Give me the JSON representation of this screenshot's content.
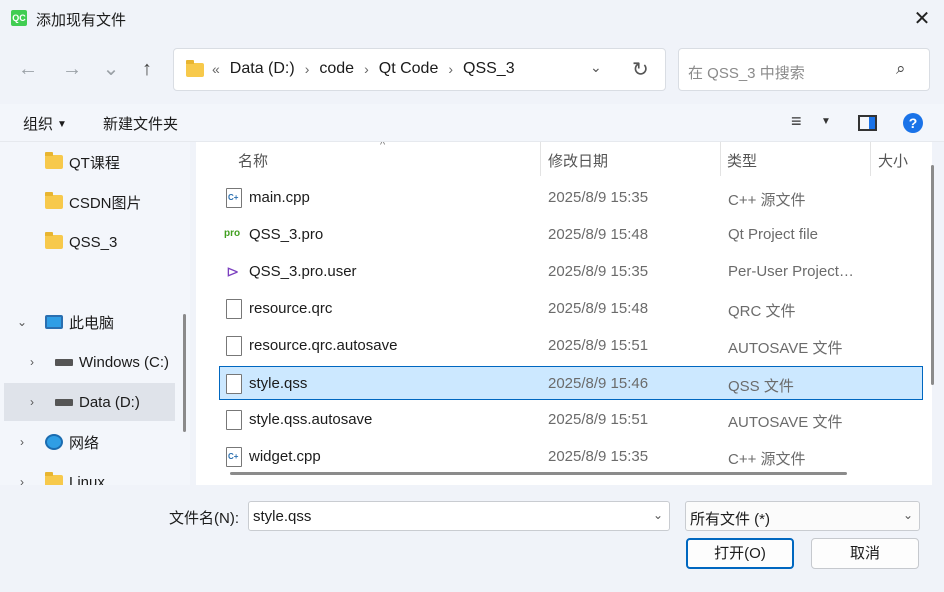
{
  "window": {
    "app_icon_text": "QC",
    "title": "添加现有文件",
    "close_glyph": "✕"
  },
  "nav": {
    "back_glyph": "←",
    "forward_glyph": "→",
    "recent_glyph": "⌄",
    "up_glyph": "↑"
  },
  "address": {
    "overflow": "«",
    "crumbs": [
      "Data (D:)",
      "code",
      "Qt Code",
      "QSS_3"
    ],
    "separator": "›",
    "dropdown_glyph": "⌄",
    "refresh_glyph": "↻"
  },
  "search": {
    "placeholder": "在 QSS_3 中搜索",
    "icon_glyph": "⌕"
  },
  "toolbar": {
    "organize": "组织",
    "organize_caret": "▼",
    "new_folder": "新建文件夹",
    "view_glyph": "≡",
    "view_caret": "▼",
    "help_glyph": "?"
  },
  "sidebar": {
    "items": [
      {
        "label": "QT课程",
        "icon": "folder-icon"
      },
      {
        "label": "CSDN图片",
        "icon": "folder-icon"
      },
      {
        "label": "QSS_3",
        "icon": "folder-icon"
      },
      {
        "label": "此电脑",
        "icon": "computer-icon",
        "expander": "⌄"
      },
      {
        "label": "Windows (C:)",
        "icon": "windows-drive-icon",
        "expander": "›"
      },
      {
        "label": "Data (D:)",
        "icon": "drive-icon",
        "expander": "›",
        "selected": true
      },
      {
        "label": "网络",
        "icon": "network-icon",
        "expander": "›"
      },
      {
        "label": "Linux",
        "icon": "folder-icon",
        "expander": "›"
      }
    ]
  },
  "filelist": {
    "columns": {
      "name": "名称",
      "modified": "修改日期",
      "type": "类型",
      "size": "大小"
    },
    "sort_glyph": "^",
    "rows": [
      {
        "name": "main.cpp",
        "modified": "2025/8/9 15:35",
        "type": "C++ 源文件",
        "icon": "cpp-file-icon"
      },
      {
        "name": "QSS_3.pro",
        "modified": "2025/8/9 15:48",
        "type": "Qt Project file",
        "icon": "qt-pro-icon"
      },
      {
        "name": "QSS_3.pro.user",
        "modified": "2025/8/9 15:35",
        "type": "Per-User Project…",
        "icon": "visual-studio-icon"
      },
      {
        "name": "resource.qrc",
        "modified": "2025/8/9 15:48",
        "type": "QRC 文件",
        "icon": "file-icon"
      },
      {
        "name": "resource.qrc.autosave",
        "modified": "2025/8/9 15:51",
        "type": "AUTOSAVE 文件",
        "icon": "file-icon"
      },
      {
        "name": "style.qss",
        "modified": "2025/8/9 15:46",
        "type": "QSS 文件",
        "icon": "file-icon",
        "selected": true
      },
      {
        "name": "style.qss.autosave",
        "modified": "2025/8/9 15:51",
        "type": "AUTOSAVE 文件",
        "icon": "file-icon"
      },
      {
        "name": "widget.cpp",
        "modified": "2025/8/9 15:35",
        "type": "C++ 源文件",
        "icon": "cpp-file-icon"
      }
    ]
  },
  "footer": {
    "filename_label": "文件名(N):",
    "filename_value": "style.qss",
    "filter_value": "所有文件 (*)",
    "dropdown_glyph": "⌄",
    "open_button": "打开(O)",
    "cancel_button": "取消"
  },
  "colors": {
    "selection_bg": "#cce8ff",
    "selection_border": "#0067c0",
    "accent": "#1a73e8"
  }
}
